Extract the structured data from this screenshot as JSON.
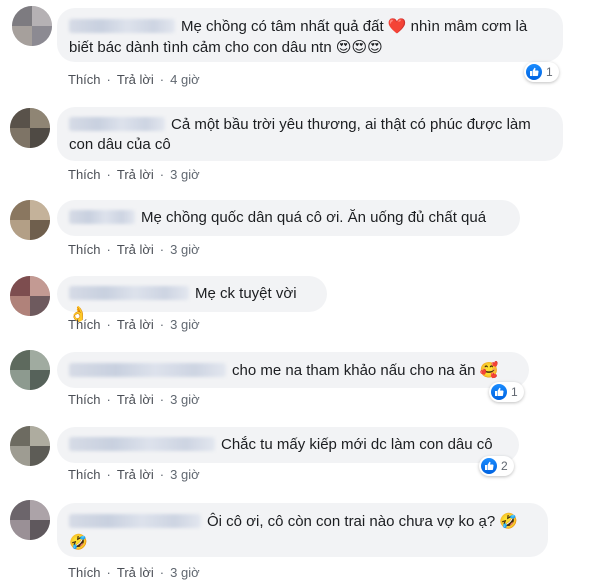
{
  "actions": {
    "like": "Thích",
    "reply": "Trả lời",
    "sep": "·"
  },
  "comments": [
    {
      "text1": "Mẹ chồng có tâm nhất quả đất",
      "emoji1": "❤️",
      "text2": " nhìn mâm cơm là",
      "text3": "biết bác dành tình cảm cho con dâu ntn ",
      "emoji2": "😍😍😍",
      "time": "4 giờ",
      "reactions": "1"
    },
    {
      "text1": "Cả một bầu trời yêu thương, ai thật có phúc được làm",
      "text2": "con dâu của cô",
      "time": "3 giờ"
    },
    {
      "text1": "Mẹ chồng quốc dân quá cô ơi. Ăn uống đủ chất quá",
      "time": "3 giờ"
    },
    {
      "text1": "Mẹ ck tuyệt vời ",
      "emoji1": "👌",
      "time": "3 giờ"
    },
    {
      "text1": "cho me na tham khảo nấu cho na ăn ",
      "emoji1": "🥰",
      "time": "3 giờ",
      "reactions": "1"
    },
    {
      "text1": "Chắc tu mấy kiếp mới dc làm con dâu cô",
      "time": "3 giờ",
      "reactions": "2"
    },
    {
      "text1": "Ôi cô ơi, cô còn con trai nào chưa vợ ko ạ? ",
      "emoji1": "🤣",
      "emoji2": "🤣",
      "time": "3 giờ"
    }
  ]
}
